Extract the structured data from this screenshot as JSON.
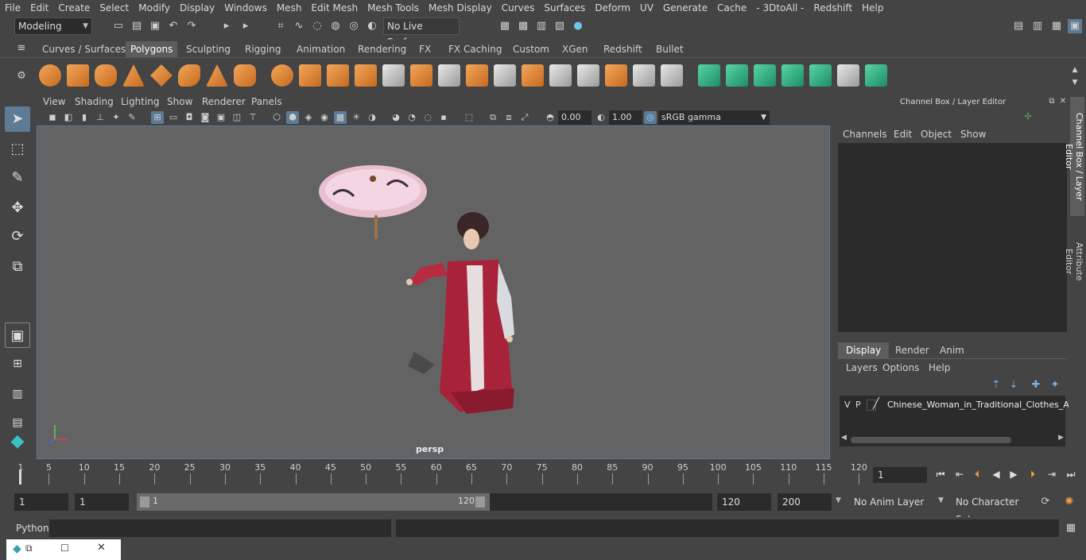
{
  "menubar": {
    "items": [
      "File",
      "Edit",
      "Create",
      "Select",
      "Modify",
      "Display",
      "Windows",
      "Mesh",
      "Edit Mesh",
      "Mesh Tools",
      "Mesh Display",
      "Curves",
      "Surfaces",
      "Deform",
      "UV",
      "Generate",
      "Cache",
      "- 3DtoAll -",
      "Redshift",
      "Help"
    ]
  },
  "statusline": {
    "workspace": "Modeling",
    "live_surface": "No Live Surface"
  },
  "shelf": {
    "tabs": [
      "Curves / Surfaces",
      "Polygons",
      "Sculpting",
      "Rigging",
      "Animation",
      "Rendering",
      "FX",
      "FX Caching",
      "Custom",
      "XGen",
      "Redshift",
      "Bullet"
    ],
    "active_tab": "Polygons"
  },
  "viewport": {
    "menu": [
      "View",
      "Shading",
      "Lighting",
      "Show",
      "Renderer",
      "Panels"
    ],
    "exposure": "0.00",
    "gamma": "1.00",
    "color_space": "sRGB gamma",
    "camera_label": "persp"
  },
  "channel_box": {
    "title": "Channel Box / Layer Editor",
    "menu": [
      "Channels",
      "Edit",
      "Object",
      "Show"
    ]
  },
  "layer_editor": {
    "tabs": [
      "Display",
      "Render",
      "Anim"
    ],
    "active_tab": "Display",
    "menu": [
      "Layers",
      "Options",
      "Help"
    ],
    "layers": [
      {
        "v": "V",
        "p": "P",
        "name": "Chinese_Woman_in_Traditional_Clothes_A_"
      }
    ]
  },
  "side_tabs": [
    "Channel Box / Layer Editor",
    "Attribute Editor"
  ],
  "timeline": {
    "ticks": [
      5,
      10,
      15,
      20,
      25,
      30,
      35,
      40,
      45,
      50,
      55,
      60,
      65,
      70,
      75,
      80,
      85,
      90,
      95,
      100,
      105,
      110,
      115,
      120
    ],
    "start_label": "1",
    "current_frame": "1"
  },
  "range": {
    "start": "1",
    "playback_start": "1",
    "slider_start": "1",
    "slider_end": "120",
    "playback_end": "120",
    "end": "200",
    "anim_layer": "No Anim Layer",
    "character_set": "No Character Set"
  },
  "python": {
    "label": "Python"
  },
  "colors": {
    "panel": "#444444",
    "viewport_bg": "#636363",
    "field_bg": "#2b2b2b",
    "accent_blue": "#5d7a96",
    "shelf_orange": "#e8924a",
    "shelf_green": "#3cc68f"
  }
}
